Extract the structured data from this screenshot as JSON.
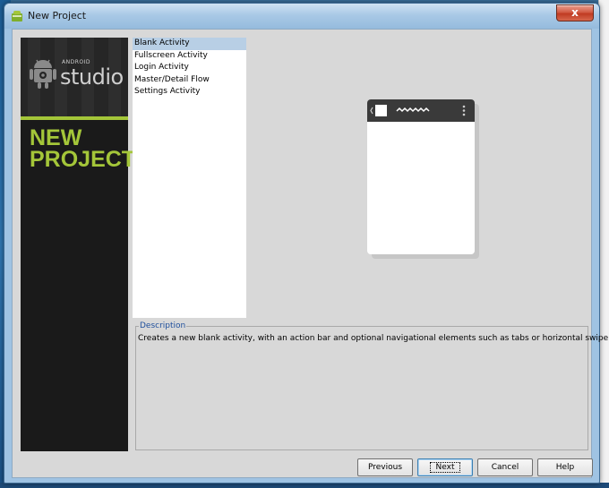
{
  "window": {
    "title": "New Project",
    "close_label": "x"
  },
  "banner": {
    "brand_small": "ANDROID",
    "brand_large": "studio",
    "heading_line1": "NEW",
    "heading_line2": "PROJECT"
  },
  "activities": {
    "items": [
      {
        "label": "Blank Activity",
        "selected": true
      },
      {
        "label": "Fullscreen Activity",
        "selected": false
      },
      {
        "label": "Login Activity",
        "selected": false
      },
      {
        "label": "Master/Detail Flow",
        "selected": false
      },
      {
        "label": "Settings Activity",
        "selected": false
      }
    ]
  },
  "description": {
    "legend": "Description",
    "text": "Creates a new blank activity, with an action bar and optional navigational elements such as tabs or horizontal swipe."
  },
  "buttons": {
    "previous": "Previous",
    "next": "Next",
    "cancel": "Cancel",
    "help": "Help"
  },
  "colors": {
    "android_green": "#a4c639",
    "selection": "#b8cfe5",
    "legend_blue": "#1f4f9c"
  }
}
